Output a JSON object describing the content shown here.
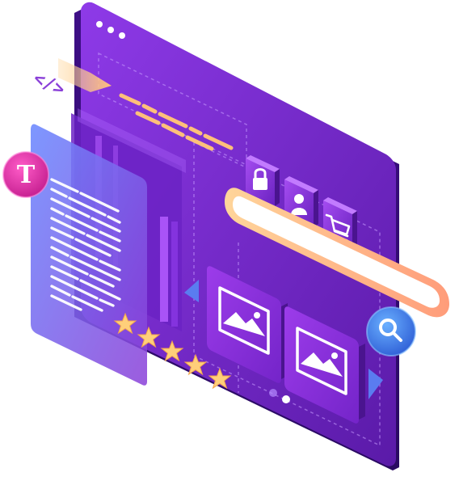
{
  "illustration": {
    "code_tag_text": "</>",
    "text_badge_letter": "T",
    "rating_stars": 5,
    "carousel_dots": 2,
    "carousel_active_dot": 2,
    "icons": [
      "code-icon",
      "text-icon",
      "lock-icon",
      "user-icon",
      "cart-icon",
      "image-icon",
      "search-icon",
      "star-icon"
    ],
    "colors": {
      "window": "#7a2fd6",
      "window_dark": "#4a148f",
      "accent_orange": "#ffc38a",
      "accent_yellow": "#ffd98a",
      "badge_pink": "#d62ba3",
      "search_blue": "#3b7cf0",
      "glass_blue": "#5b6de8"
    }
  }
}
